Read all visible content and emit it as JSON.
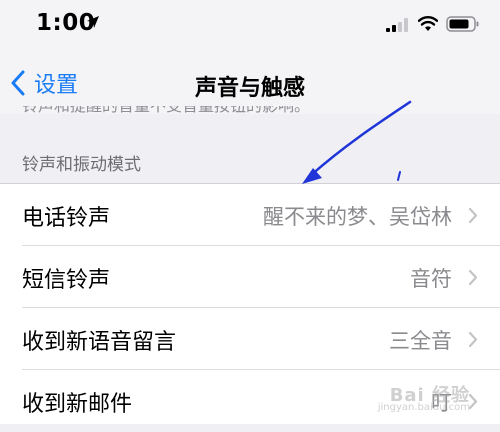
{
  "status_bar": {
    "time": "1:00",
    "location_icon": "location-arrow-icon",
    "signal_icon": "cellular-signal-icon",
    "wifi_icon": "wifi-icon",
    "battery_icon": "battery-icon"
  },
  "nav": {
    "back_label": "设置",
    "back_icon": "chevron-left-icon",
    "title": "声音与触感"
  },
  "cut_off_text": "铃声和提醒的音量不受音量按钮的影响。",
  "section": {
    "header": "铃声和振动模式"
  },
  "rows": [
    {
      "label": "电话铃声",
      "value": "醒不来的梦、吴岱林"
    },
    {
      "label": "短信铃声",
      "value": "音符"
    },
    {
      "label": "收到新语音留言",
      "value": "三全音"
    },
    {
      "label": "收到新邮件",
      "value": "叮"
    }
  ],
  "colors": {
    "accent": "#1a7cf5",
    "annotation_arrow": "#2035d8"
  },
  "watermark": {
    "text": "Bai 经验",
    "sub": "jingyan.baidu.com"
  }
}
